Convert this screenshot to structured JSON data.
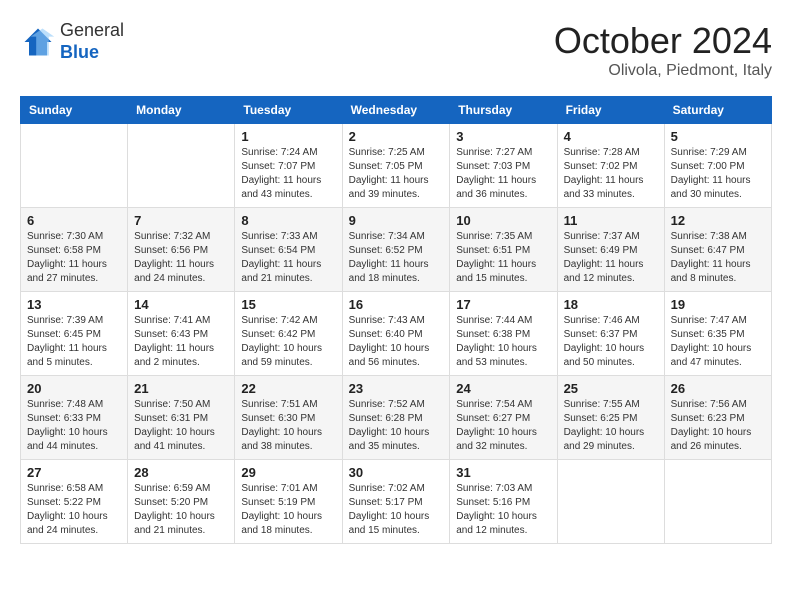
{
  "header": {
    "logo_general": "General",
    "logo_blue": "Blue",
    "month": "October 2024",
    "location": "Olivola, Piedmont, Italy"
  },
  "days_of_week": [
    "Sunday",
    "Monday",
    "Tuesday",
    "Wednesday",
    "Thursday",
    "Friday",
    "Saturday"
  ],
  "weeks": [
    [
      {
        "day": "",
        "info": ""
      },
      {
        "day": "",
        "info": ""
      },
      {
        "day": "1",
        "info": "Sunrise: 7:24 AM\nSunset: 7:07 PM\nDaylight: 11 hours and 43 minutes."
      },
      {
        "day": "2",
        "info": "Sunrise: 7:25 AM\nSunset: 7:05 PM\nDaylight: 11 hours and 39 minutes."
      },
      {
        "day": "3",
        "info": "Sunrise: 7:27 AM\nSunset: 7:03 PM\nDaylight: 11 hours and 36 minutes."
      },
      {
        "day": "4",
        "info": "Sunrise: 7:28 AM\nSunset: 7:02 PM\nDaylight: 11 hours and 33 minutes."
      },
      {
        "day": "5",
        "info": "Sunrise: 7:29 AM\nSunset: 7:00 PM\nDaylight: 11 hours and 30 minutes."
      }
    ],
    [
      {
        "day": "6",
        "info": "Sunrise: 7:30 AM\nSunset: 6:58 PM\nDaylight: 11 hours and 27 minutes."
      },
      {
        "day": "7",
        "info": "Sunrise: 7:32 AM\nSunset: 6:56 PM\nDaylight: 11 hours and 24 minutes."
      },
      {
        "day": "8",
        "info": "Sunrise: 7:33 AM\nSunset: 6:54 PM\nDaylight: 11 hours and 21 minutes."
      },
      {
        "day": "9",
        "info": "Sunrise: 7:34 AM\nSunset: 6:52 PM\nDaylight: 11 hours and 18 minutes."
      },
      {
        "day": "10",
        "info": "Sunrise: 7:35 AM\nSunset: 6:51 PM\nDaylight: 11 hours and 15 minutes."
      },
      {
        "day": "11",
        "info": "Sunrise: 7:37 AM\nSunset: 6:49 PM\nDaylight: 11 hours and 12 minutes."
      },
      {
        "day": "12",
        "info": "Sunrise: 7:38 AM\nSunset: 6:47 PM\nDaylight: 11 hours and 8 minutes."
      }
    ],
    [
      {
        "day": "13",
        "info": "Sunrise: 7:39 AM\nSunset: 6:45 PM\nDaylight: 11 hours and 5 minutes."
      },
      {
        "day": "14",
        "info": "Sunrise: 7:41 AM\nSunset: 6:43 PM\nDaylight: 11 hours and 2 minutes."
      },
      {
        "day": "15",
        "info": "Sunrise: 7:42 AM\nSunset: 6:42 PM\nDaylight: 10 hours and 59 minutes."
      },
      {
        "day": "16",
        "info": "Sunrise: 7:43 AM\nSunset: 6:40 PM\nDaylight: 10 hours and 56 minutes."
      },
      {
        "day": "17",
        "info": "Sunrise: 7:44 AM\nSunset: 6:38 PM\nDaylight: 10 hours and 53 minutes."
      },
      {
        "day": "18",
        "info": "Sunrise: 7:46 AM\nSunset: 6:37 PM\nDaylight: 10 hours and 50 minutes."
      },
      {
        "day": "19",
        "info": "Sunrise: 7:47 AM\nSunset: 6:35 PM\nDaylight: 10 hours and 47 minutes."
      }
    ],
    [
      {
        "day": "20",
        "info": "Sunrise: 7:48 AM\nSunset: 6:33 PM\nDaylight: 10 hours and 44 minutes."
      },
      {
        "day": "21",
        "info": "Sunrise: 7:50 AM\nSunset: 6:31 PM\nDaylight: 10 hours and 41 minutes."
      },
      {
        "day": "22",
        "info": "Sunrise: 7:51 AM\nSunset: 6:30 PM\nDaylight: 10 hours and 38 minutes."
      },
      {
        "day": "23",
        "info": "Sunrise: 7:52 AM\nSunset: 6:28 PM\nDaylight: 10 hours and 35 minutes."
      },
      {
        "day": "24",
        "info": "Sunrise: 7:54 AM\nSunset: 6:27 PM\nDaylight: 10 hours and 32 minutes."
      },
      {
        "day": "25",
        "info": "Sunrise: 7:55 AM\nSunset: 6:25 PM\nDaylight: 10 hours and 29 minutes."
      },
      {
        "day": "26",
        "info": "Sunrise: 7:56 AM\nSunset: 6:23 PM\nDaylight: 10 hours and 26 minutes."
      }
    ],
    [
      {
        "day": "27",
        "info": "Sunrise: 6:58 AM\nSunset: 5:22 PM\nDaylight: 10 hours and 24 minutes."
      },
      {
        "day": "28",
        "info": "Sunrise: 6:59 AM\nSunset: 5:20 PM\nDaylight: 10 hours and 21 minutes."
      },
      {
        "day": "29",
        "info": "Sunrise: 7:01 AM\nSunset: 5:19 PM\nDaylight: 10 hours and 18 minutes."
      },
      {
        "day": "30",
        "info": "Sunrise: 7:02 AM\nSunset: 5:17 PM\nDaylight: 10 hours and 15 minutes."
      },
      {
        "day": "31",
        "info": "Sunrise: 7:03 AM\nSunset: 5:16 PM\nDaylight: 10 hours and 12 minutes."
      },
      {
        "day": "",
        "info": ""
      },
      {
        "day": "",
        "info": ""
      }
    ]
  ]
}
